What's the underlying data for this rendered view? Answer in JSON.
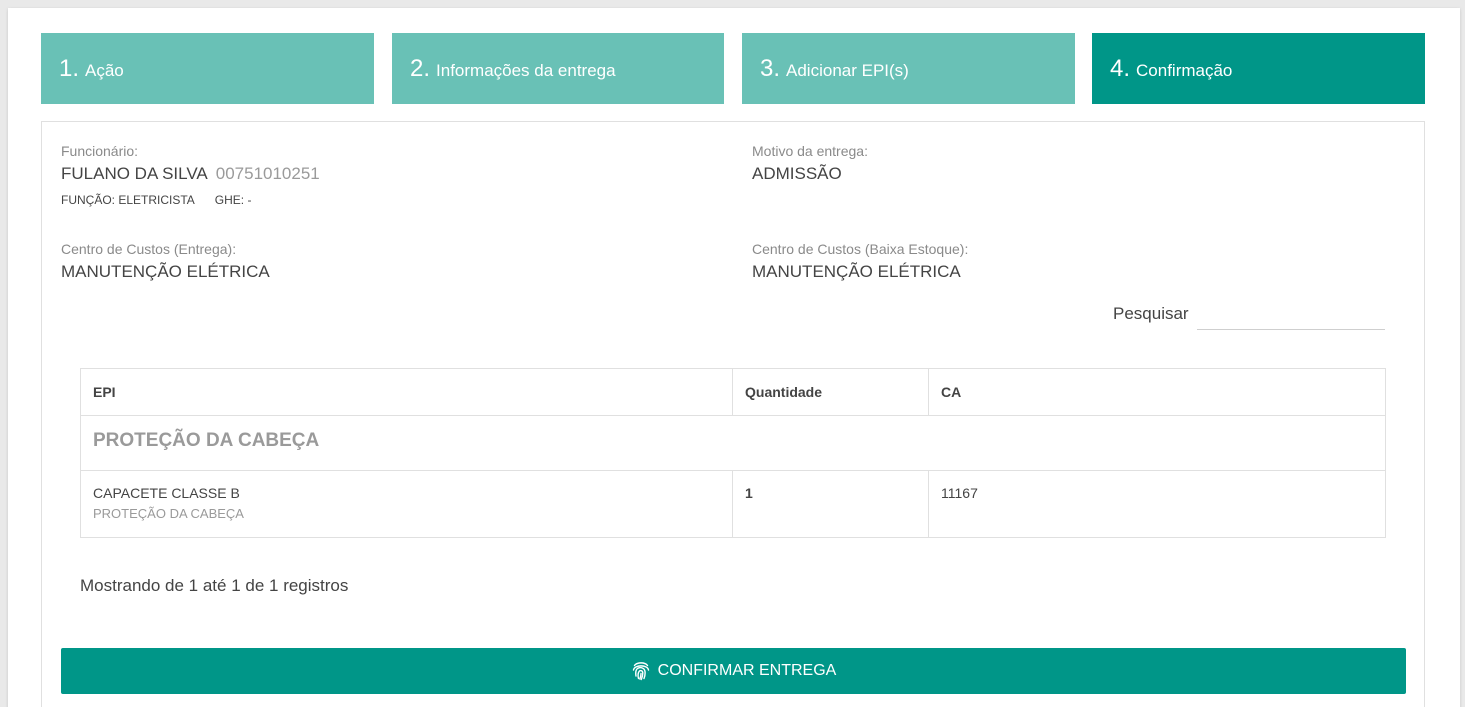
{
  "steps": [
    {
      "num": "1.",
      "label": "Ação"
    },
    {
      "num": "2.",
      "label": "Informações da entrega"
    },
    {
      "num": "3.",
      "label": "Adicionar EPI(s)"
    },
    {
      "num": "4.",
      "label": "Confirmação"
    }
  ],
  "employee": {
    "label": "Funcionário:",
    "name": "FULANO DA SILVA",
    "id": "00751010251",
    "role": "FUNÇÃO: ELETRICISTA",
    "ghe": "GHE: -"
  },
  "reason": {
    "label": "Motivo da entrega:",
    "value": "ADMISSÃO"
  },
  "cost_center_delivery": {
    "label": "Centro de Custos (Entrega):",
    "value": "MANUTENÇÃO ELÉTRICA"
  },
  "cost_center_stock": {
    "label": "Centro de Custos (Baixa Estoque):",
    "value": "MANUTENÇÃO ELÉTRICA"
  },
  "search": {
    "label": "Pesquisar",
    "value": ""
  },
  "table": {
    "headers": [
      "EPI",
      "Quantidade",
      "CA"
    ],
    "group": "PROTEÇÃO DA CABEÇA",
    "rows": [
      {
        "name": "CAPACETE CLASSE B",
        "category": "PROTEÇÃO DA CABEÇA",
        "qty": "1",
        "ca": "11167"
      }
    ]
  },
  "table_info": "Mostrando de 1 até 1 de 1 registros",
  "confirm_label": "CONFIRMAR ENTREGA",
  "colors": {
    "step_inactive": "#69c1b6",
    "step_active": "#009688",
    "button": "#009688"
  },
  "icons": {
    "confirm": "fingerprint-icon"
  }
}
